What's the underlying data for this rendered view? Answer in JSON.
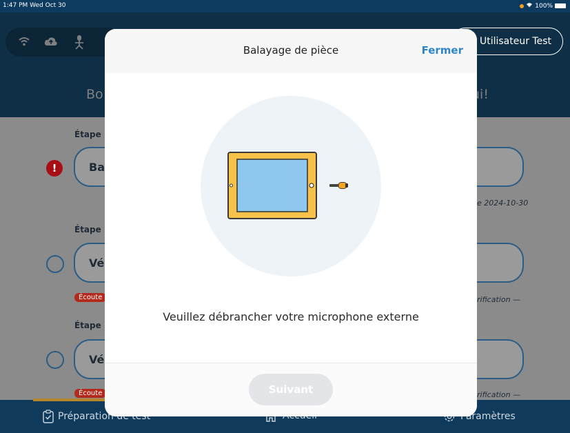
{
  "status_bar": {
    "time": "1:47 PM  Wed Oct 30",
    "battery": "100%"
  },
  "header": {
    "user_button": "Utilisateur Test",
    "greeting_left": "Bo",
    "greeting_right": "ui!"
  },
  "steps": [
    {
      "label": "Étape",
      "button": "Ba",
      "side_text": "e 2024-10-30",
      "status": "error"
    },
    {
      "label": "Étape",
      "button": "Vé",
      "tag": "Écoute",
      "side_text": "rification —",
      "status": "pending"
    },
    {
      "label": "Étape",
      "button": "Vé",
      "tag": "Écoute",
      "side_text": "rification —",
      "status": "pending"
    }
  ],
  "tabbar": {
    "tabs": [
      {
        "label": "Préparation de test",
        "icon": "clipboard-check-icon"
      },
      {
        "label": "Accueil",
        "icon": "home-icon"
      },
      {
        "label": "Paramètres",
        "icon": "gear-icon"
      }
    ]
  },
  "modal": {
    "title": "Balayage de pièce",
    "close_label": "Fermer",
    "message": "Veuillez débrancher votre microphone externe",
    "next_label": "Suivant",
    "illustration": "tablet-with-microphone-unplugged"
  },
  "colors": {
    "header": "#1d5e8a",
    "accent": "#2f86c7",
    "error": "#a80e15",
    "tag": "#b32a1c",
    "tablet_frame": "#f6c24a",
    "tablet_screen": "#8ec8ef"
  }
}
